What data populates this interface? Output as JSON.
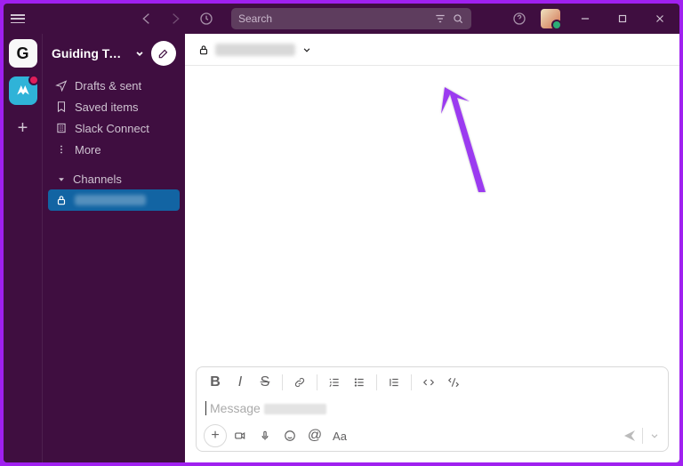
{
  "titlebar": {
    "search_placeholder": "Search"
  },
  "workspace": {
    "name": "Guiding Tec...",
    "tile1": "G",
    "tile2": " "
  },
  "sidebar": {
    "items": [
      {
        "label": "Drafts & sent"
      },
      {
        "label": "Saved items"
      },
      {
        "label": "Slack Connect"
      },
      {
        "label": "More"
      }
    ],
    "section_channels": "Channels"
  },
  "composer": {
    "placeholder": "Message"
  }
}
